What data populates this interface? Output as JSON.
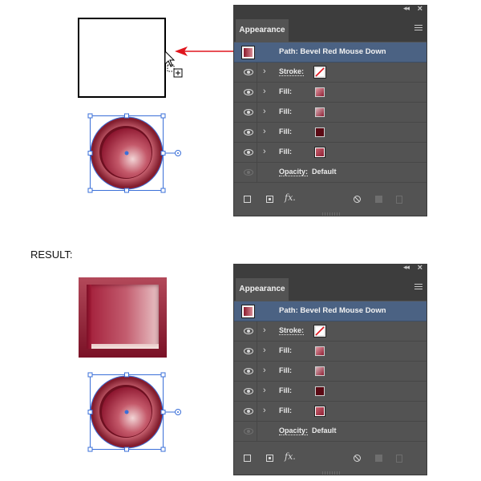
{
  "panels": [
    {
      "tab": "Appearance",
      "header_title": "Path: Bevel Red Mouse Down",
      "rows": [
        {
          "label": "Stroke:",
          "kind": "stroke",
          "swatch": "none-stroke"
        },
        {
          "label": "Fill:",
          "kind": "fill",
          "swatch": "gradient-red"
        },
        {
          "label": "Fill:",
          "kind": "fill",
          "swatch": "gradient-red-light"
        },
        {
          "label": "Fill:",
          "kind": "fill",
          "swatch": "dark-red"
        },
        {
          "label": "Fill:",
          "kind": "fill",
          "swatch": "gradient-red-bevel"
        }
      ],
      "opacity_label": "Opacity:",
      "opacity_value": "Default",
      "fx_label": "fx."
    },
    {
      "tab": "Appearance",
      "header_title": "Path: Bevel Red Mouse Down",
      "rows": [
        {
          "label": "Stroke:",
          "kind": "stroke",
          "swatch": "none-stroke"
        },
        {
          "label": "Fill:",
          "kind": "fill",
          "swatch": "gradient-red"
        },
        {
          "label": "Fill:",
          "kind": "fill",
          "swatch": "gradient-red-light"
        },
        {
          "label": "Fill:",
          "kind": "fill",
          "swatch": "dark-red"
        },
        {
          "label": "Fill:",
          "kind": "fill",
          "swatch": "gradient-red-bevel"
        }
      ],
      "opacity_label": "Opacity:",
      "opacity_value": "Default",
      "fx_label": "fx."
    }
  ],
  "result_label": "RESULT:",
  "colors": {
    "panel_bg": "#535353",
    "header_highlight": "#4b6283",
    "arrow": "#e0161e",
    "selection": "#3a6fd8"
  },
  "icons": [
    "eye-icon",
    "chevron-right-icon",
    "panel-menu-icon",
    "collapse-icon",
    "close-icon",
    "add-stroke-icon",
    "add-fill-icon",
    "fx-icon",
    "clear-appearance-icon",
    "duplicate-icon",
    "trash-icon",
    "drag-copy-cursor-icon",
    "arrow-icon"
  ]
}
